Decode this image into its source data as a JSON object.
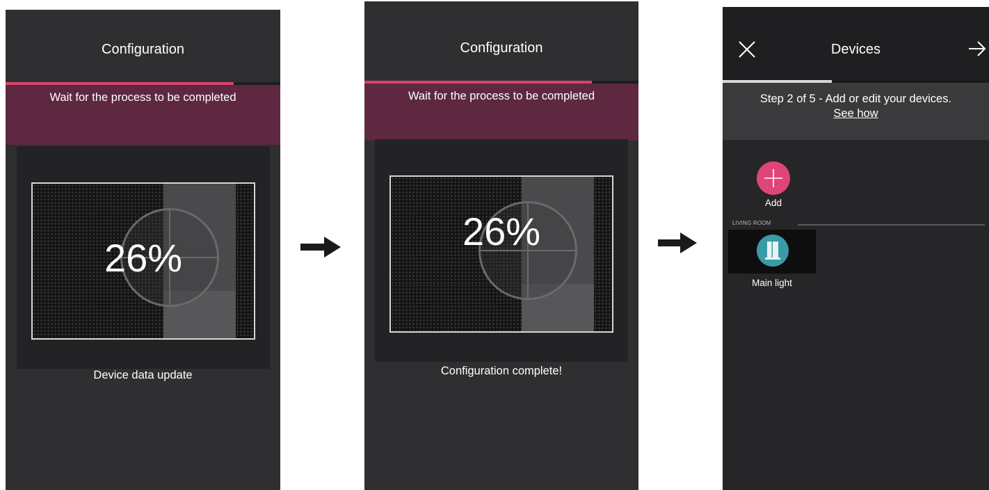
{
  "screen1": {
    "title": "Configuration",
    "progress": 0.83,
    "banner": "Wait for the process to be completed",
    "percent": "26%",
    "caption": "Device data update"
  },
  "screen2": {
    "title": "Configuration",
    "progress": 0.83,
    "banner": "Wait for the process to be completed",
    "percent": "26%",
    "caption": "Configuration complete!"
  },
  "screen3": {
    "title": "Devices",
    "progress": 0.41,
    "step_text": "Step 2 of 5 - Add or edit your devices.",
    "help_link": "See how",
    "add_label": "Add",
    "room_label": "LIVING ROOM",
    "device_label": "Main light"
  },
  "colors": {
    "accent": "#e0457a",
    "banner": "#5e2841",
    "progress": "#d9446e",
    "progress_light": "#d8d8d8",
    "device_icon": "#3a9aa6"
  },
  "icons": {
    "flow_arrow": "right-arrow-icon",
    "close": "close-icon",
    "next": "arrow-right-icon",
    "add": "plus-icon",
    "device": "light-icon"
  }
}
